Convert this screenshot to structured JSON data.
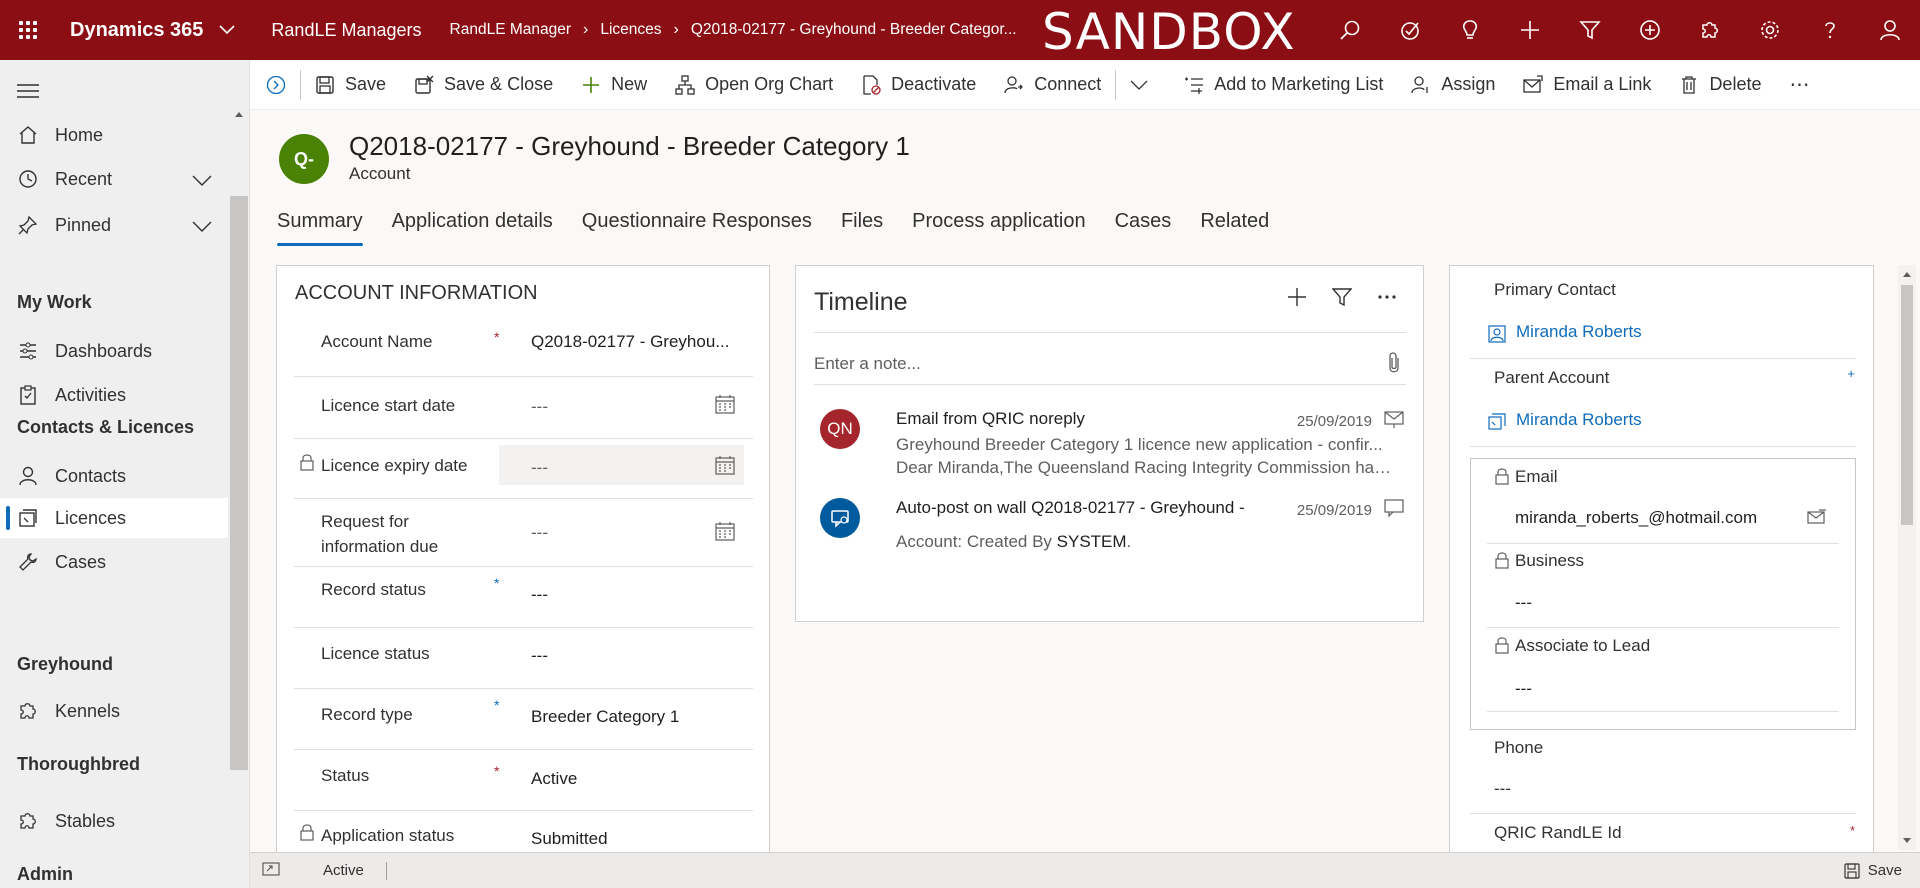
{
  "topbar": {
    "app_name": "Dynamics 365",
    "module": "RandLE Managers",
    "breadcrumbs": [
      "RandLE Manager",
      "Licences",
      "Q2018-02177 - Greyhound - Breeder Categor..."
    ],
    "environment_banner": "SANDBOX",
    "icons": [
      "search-icon",
      "task-icon",
      "lightbulb-icon",
      "plus-icon",
      "filter-icon",
      "circle-plus-icon",
      "puzzle-icon",
      "gear-icon",
      "help-icon",
      "user-icon"
    ]
  },
  "nav": {
    "items": [
      {
        "label": "Home",
        "icon": "home-icon"
      },
      {
        "label": "Recent",
        "icon": "clock-icon"
      },
      {
        "label": "Pinned",
        "icon": "pin-icon"
      }
    ],
    "groups": [
      {
        "title": "My Work",
        "items": [
          {
            "label": "Dashboards",
            "icon": "dashboard-icon"
          },
          {
            "label": "Activities",
            "icon": "clipboard-icon"
          }
        ]
      },
      {
        "title": "Contacts & Licences",
        "items": [
          {
            "label": "Contacts",
            "icon": "person-icon"
          },
          {
            "label": "Licences",
            "icon": "licence-icon"
          },
          {
            "label": "Cases",
            "icon": "wrench-icon"
          }
        ]
      },
      {
        "title": "Greyhound",
        "items": [
          {
            "label": "Kennels",
            "icon": "puzzle-icon"
          }
        ]
      },
      {
        "title": "Thoroughbred",
        "items": [
          {
            "label": "Stables",
            "icon": "puzzle-icon"
          }
        ]
      },
      {
        "title": "Admin",
        "items": []
      }
    ]
  },
  "commands": {
    "save": "Save",
    "save_close": "Save & Close",
    "new": "New",
    "org_chart": "Open Org Chart",
    "deactivate": "Deactivate",
    "connect": "Connect",
    "add_marketing": "Add to Marketing List",
    "assign": "Assign",
    "email_link": "Email a Link",
    "delete": "Delete",
    "more": "⋯"
  },
  "record": {
    "avatar": "Q-",
    "title": "Q2018-02177 - Greyhound - Breeder Category 1",
    "entity": "Account"
  },
  "tabs": [
    "Summary",
    "Application details",
    "Questionnaire Responses",
    "Files",
    "Process application",
    "Cases",
    "Related"
  ],
  "account_info": {
    "title": "ACCOUNT INFORMATION",
    "fields": [
      {
        "label": "Account Name",
        "value": "Q2018-02177 - Greyhou...",
        "required": "*"
      },
      {
        "label": "Licence start date",
        "value": "---"
      },
      {
        "label": "Licence expiry date",
        "value": "---"
      },
      {
        "label": "Request for information due",
        "value": "---"
      },
      {
        "label": "Record status",
        "value": "---",
        "required": "*"
      },
      {
        "label": "Licence status",
        "value": "---"
      },
      {
        "label": "Record type",
        "value": "Breeder Category 1",
        "required": "*"
      },
      {
        "label": "Status",
        "value": "Active",
        "required": "*"
      },
      {
        "label": "Application status",
        "value": "Submitted"
      }
    ]
  },
  "timeline": {
    "title": "Timeline",
    "note_placeholder": "Enter a note...",
    "items": [
      {
        "avatar": "QN",
        "avatar_color": "#a4262c",
        "title": "Email from QRIC noreply",
        "date": "25/09/2019",
        "line1": "Greyhound Breeder Category 1 licence new application - confir...",
        "line2": "Dear Miranda,The Queensland Racing Integrity Commission has ..."
      },
      {
        "avatar_color": "#005a9e",
        "title": "Auto-post on wall Q2018-02177 - Greyhound -",
        "date": "25/09/2019",
        "line1_prefix": "Account: Created By ",
        "line1_bold": "SYSTEM",
        "line1_suffix": "."
      }
    ]
  },
  "side": {
    "primary_contact_label": "Primary Contact",
    "primary_contact": "Miranda Roberts",
    "parent_account_label": "Parent Account",
    "parent_account": "Miranda Roberts",
    "email_label": "Email",
    "email": "miranda_roberts_@hotmail.com",
    "business_label": "Business",
    "business": "---",
    "associate_label": "Associate to Lead",
    "associate": "---",
    "phone_label": "Phone",
    "phone": "---",
    "qric_label": "QRIC RandLE Id",
    "req_star": "*",
    "rec_star": "+"
  },
  "statusbar": {
    "status": "Active",
    "save": "Save"
  }
}
